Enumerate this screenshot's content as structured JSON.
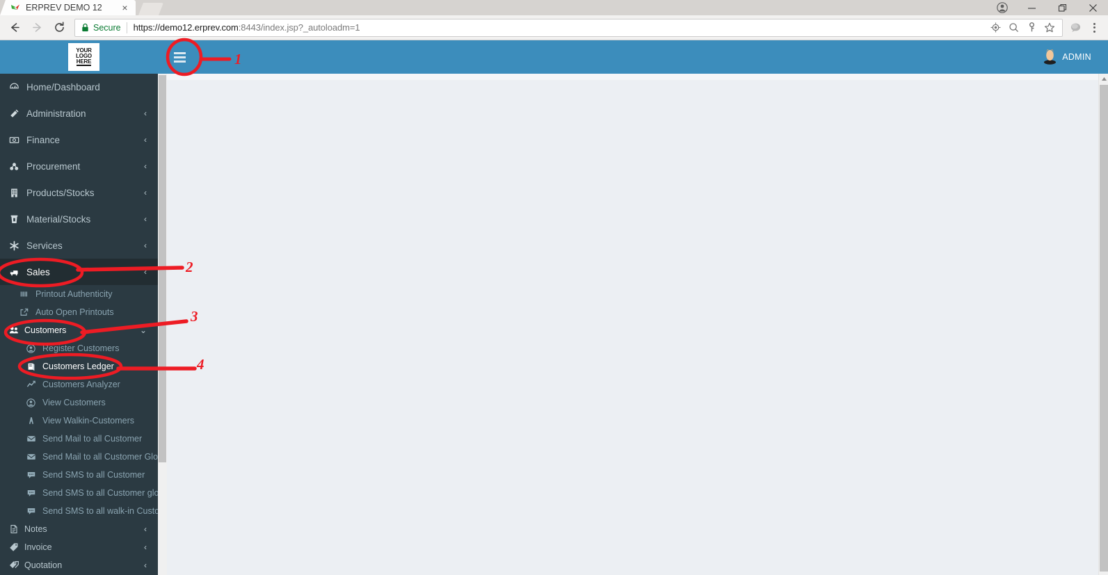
{
  "browser": {
    "tab": {
      "title": "ERPREV DEMO 12",
      "favicon": "bird-logo-icon",
      "close": "×"
    },
    "window_controls": {
      "profile": "profile-icon",
      "minimize": "—",
      "maximize": "▢",
      "close": "✕"
    },
    "nav": {
      "back": "←",
      "forward": "→",
      "reload": "⟳"
    },
    "omnibox": {
      "security_label": "Secure",
      "lock": "lock-icon",
      "url_scheme": "https://",
      "url_host": "demo12.erprev.com",
      "url_port": ":8443",
      "url_path": "/index.jsp?_autoloadm=1",
      "url_full": "https://demo12.erprev.com:8443/index.jsp?_autoloadm=1",
      "icons": [
        "location-target-icon",
        "zoom-search-icon",
        "key-password-icon",
        "bookmark-star-icon"
      ]
    },
    "toolbar_right": {
      "extension": "extension-cloud-icon",
      "menu": "three-dots-menu-icon"
    }
  },
  "app": {
    "header": {
      "logo_line1": "YOUR",
      "logo_line2": "LOGO",
      "logo_line3": "HERE",
      "hamburger": "hamburger-menu-icon",
      "user_name": "ADMIN",
      "avatar": "user-avatar-icon",
      "accent_color": "#3c8dbc"
    },
    "sidebar": {
      "bg_color": "#2b3a42",
      "active_bg_color": "#222d32",
      "items": [
        {
          "label": "Home/Dashboard",
          "icon": "dashboard-icon",
          "chevron": "",
          "level": 0,
          "state": "normal"
        },
        {
          "label": "Administration",
          "icon": "admin-tools-icon",
          "chevron": "‹",
          "level": 0,
          "state": "normal"
        },
        {
          "label": "Finance",
          "icon": "money-icon",
          "chevron": "‹",
          "level": 0,
          "state": "normal"
        },
        {
          "label": "Procurement",
          "icon": "procurement-icon",
          "chevron": "‹",
          "level": 0,
          "state": "normal"
        },
        {
          "label": "Products/Stocks",
          "icon": "building-icon",
          "chevron": "‹",
          "level": 0,
          "state": "normal"
        },
        {
          "label": "Material/Stocks",
          "icon": "trash-bin-icon",
          "chevron": "‹",
          "level": 0,
          "state": "normal"
        },
        {
          "label": "Services",
          "icon": "asterisk-icon",
          "chevron": "‹",
          "level": 0,
          "state": "normal"
        },
        {
          "label": "Sales",
          "icon": "cart-icon",
          "chevron": "‹",
          "level": 0,
          "state": "active"
        }
      ],
      "sales_submenu": [
        {
          "label": "Printout Authenticity",
          "icon": "barcode-icon",
          "level": 1,
          "state": "normal"
        },
        {
          "label": "Auto Open Printouts",
          "icon": "external-link-icon",
          "level": 1,
          "state": "normal"
        },
        {
          "label": "Customers",
          "icon": "customers-icon",
          "chevron": "⌄",
          "level": 1,
          "state": "expanded"
        },
        {
          "label": "Register Customers",
          "icon": "user-circle-icon",
          "level": 2,
          "state": "normal"
        },
        {
          "label": "Customers Ledger",
          "icon": "ledger-book-icon",
          "level": 2,
          "state": "highlight"
        },
        {
          "label": "Customers Analyzer",
          "icon": "chart-line-icon",
          "level": 2,
          "state": "normal"
        },
        {
          "label": "View Customers",
          "icon": "user-circle-icon",
          "level": 2,
          "state": "normal"
        },
        {
          "label": "View Walkin-Customers",
          "icon": "walkin-icon",
          "level": 2,
          "state": "normal"
        },
        {
          "label": "Send Mail to all Customer",
          "icon": "envelope-icon",
          "level": 2,
          "state": "normal"
        },
        {
          "label": "Send Mail to all Customer Globally",
          "icon": "envelope-icon",
          "level": 2,
          "state": "normal"
        },
        {
          "label": "Send SMS to all Customer",
          "icon": "sms-bubble-icon",
          "level": 2,
          "state": "normal"
        },
        {
          "label": "Send SMS to all Customer globally",
          "icon": "sms-bubble-icon",
          "level": 2,
          "state": "normal"
        },
        {
          "label": "Send SMS to all walk-in Customer",
          "icon": "sms-bubble-icon",
          "level": 2,
          "state": "normal"
        }
      ],
      "bottom_items": [
        {
          "label": "Notes",
          "icon": "note-page-icon",
          "chevron": "‹",
          "level": 1,
          "state": "normal"
        },
        {
          "label": "Invoice",
          "icon": "tag-icon",
          "chevron": "‹",
          "level": 1,
          "state": "normal"
        },
        {
          "label": "Quotation",
          "icon": "tags-icon",
          "chevron": "‹",
          "level": 1,
          "state": "normal"
        }
      ]
    },
    "annotations": {
      "color": "#ed1c24",
      "markers": [
        {
          "number": "1",
          "target": "hamburger-menu-icon"
        },
        {
          "number": "2",
          "target": "sidebar-item-sales"
        },
        {
          "number": "3",
          "target": "sidebar-item-customers"
        },
        {
          "number": "4",
          "target": "sidebar-item-customers-ledger"
        }
      ]
    }
  }
}
